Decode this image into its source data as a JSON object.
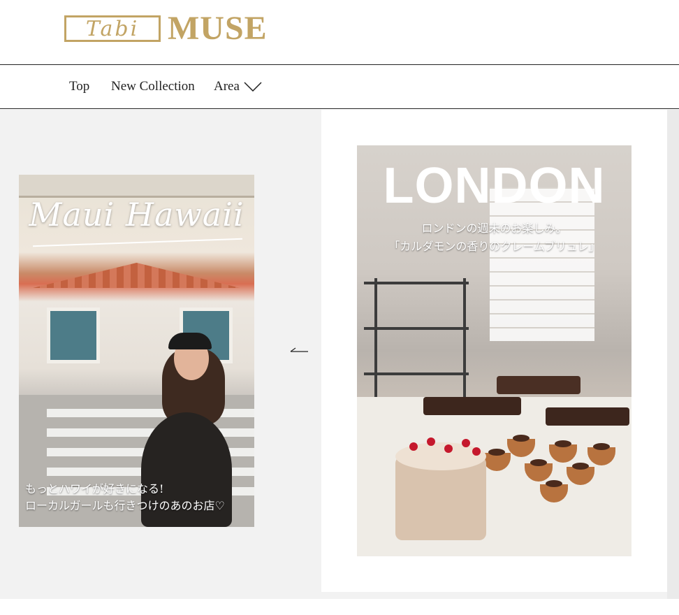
{
  "brand": {
    "logo_script": "Tabi",
    "logo_word": "MUSE",
    "color": "#c2a464"
  },
  "nav": {
    "items": [
      "Top",
      "New Collection",
      "Area"
    ],
    "area_icon": "chevron-down-icon"
  },
  "carousel": {
    "prev_icon": "arrow-left-icon",
    "cards": [
      {
        "title": "Maui Hawaii",
        "caption_lines": [
          "もっとハワイが好きになる!",
          "ローカルガールも行きつけのあのお店♡"
        ]
      },
      {
        "title": "LONDON",
        "caption_lines": [
          "ロンドンの週末のお楽しみ。",
          "「カルダモンの香りのクレームブリュレ」"
        ]
      }
    ]
  }
}
